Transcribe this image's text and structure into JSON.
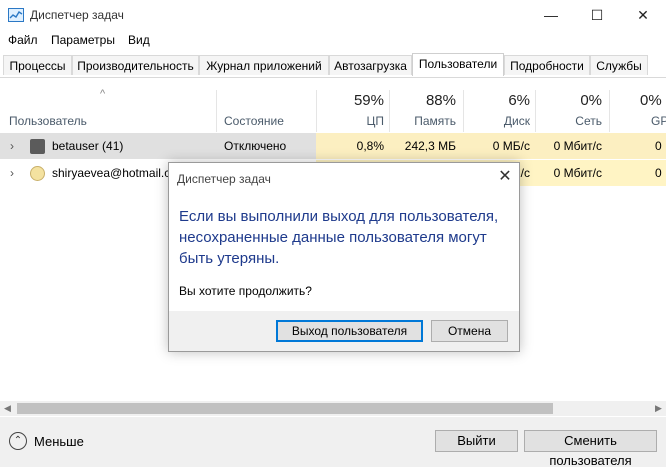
{
  "window": {
    "title": "Диспетчер задач",
    "icon": "task-manager-icon",
    "minimize_glyph": "—",
    "maximize_glyph": "☐",
    "close_glyph": "✕"
  },
  "menu": [
    "Файл",
    "Параметры",
    "Вид"
  ],
  "tabs": [
    {
      "label": "Процессы",
      "active": false
    },
    {
      "label": "Производительность",
      "active": false
    },
    {
      "label": "Журнал приложений",
      "active": false
    },
    {
      "label": "Автозагрузка",
      "active": false
    },
    {
      "label": "Пользователи",
      "active": true
    },
    {
      "label": "Подробности",
      "active": false
    },
    {
      "label": "Службы",
      "active": false
    }
  ],
  "columns": {
    "user": "Пользователь",
    "status": "Состояние",
    "cpu": {
      "pct": "59%",
      "name": "ЦП"
    },
    "memory": {
      "pct": "88%",
      "name": "Память"
    },
    "disk": {
      "pct": "6%",
      "name": "Диск"
    },
    "network": {
      "pct": "0%",
      "name": "Сеть"
    },
    "gpu": {
      "pct": "0%",
      "name": "GPU"
    }
  },
  "rows": [
    {
      "expander": "›",
      "user": "betauser (41)",
      "status": "Отключено",
      "cpu": "0,8%",
      "memory": "242,3 МБ",
      "disk": "0 МБ/с",
      "network": "0 Мбит/с",
      "gpu": "0"
    },
    {
      "expander": "›",
      "user": "shiryaevea@hotmail.c",
      "status": "",
      "cpu": "",
      "memory": "",
      "disk": "/с",
      "network": "0 Мбит/с",
      "gpu": "0"
    }
  ],
  "footer": {
    "fewer_label": "Меньше",
    "fewer_glyph": "⌃",
    "logout_button": "Выйти",
    "switch_user_button": "Сменить пользователя"
  },
  "scroll": {
    "left_glyph": "◀",
    "right_glyph": "▶"
  },
  "dialog": {
    "title": "Диспетчер задач",
    "close_glyph": "✕",
    "message_line1": "Если вы выполнили выход для пользователя,",
    "message_line2": "несохраненные данные пользователя могут",
    "message_line3": "быть утеряны.",
    "question": "Вы хотите продолжить?",
    "confirm_button": "Выход пользователя",
    "cancel_button": "Отмена"
  },
  "sort_arrow_glyph": "^",
  "colors": {
    "accent": "#0078d7",
    "dialog_text": "#1e3a8c",
    "heat_light": "#fcefc1",
    "selected_row": "#e0e0e0"
  }
}
